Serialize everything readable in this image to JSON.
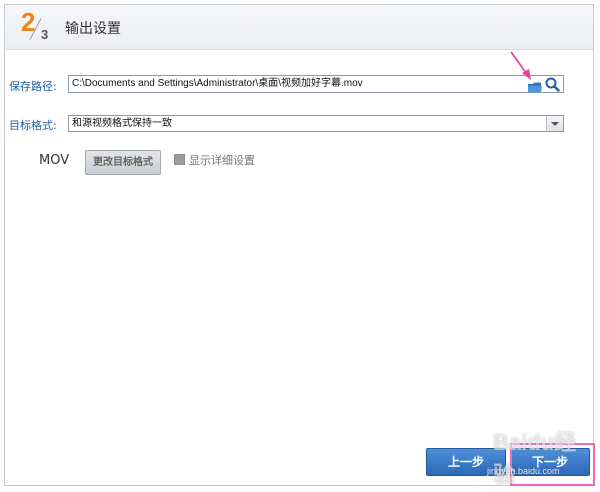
{
  "header": {
    "step_current": "2",
    "step_total": "3",
    "title": "输出设置"
  },
  "save_path": {
    "label": "保存路径:",
    "value": "C:\\Documents and Settings\\Administrator\\桌面\\视频加好字幕.mov",
    "folder_icon": "folder-icon",
    "search_icon": "search-icon"
  },
  "target_format": {
    "label": "目标格式:",
    "selected": "和源视频格式保持一致"
  },
  "format_row": {
    "format_name": "MOV",
    "change_button": "更改目标格式",
    "show_details_checkbox": "显示详细设置"
  },
  "footer": {
    "prev_button": "上一步",
    "next_button": "下一步",
    "watermark": "Baidu经验",
    "watermark_url": "jingyan.baidu.com"
  },
  "colors": {
    "accent_orange": "#f0851a",
    "label_blue": "#1f5fae",
    "button_blue": "#2b69b8",
    "annotation_pink": "#f06ab8"
  }
}
